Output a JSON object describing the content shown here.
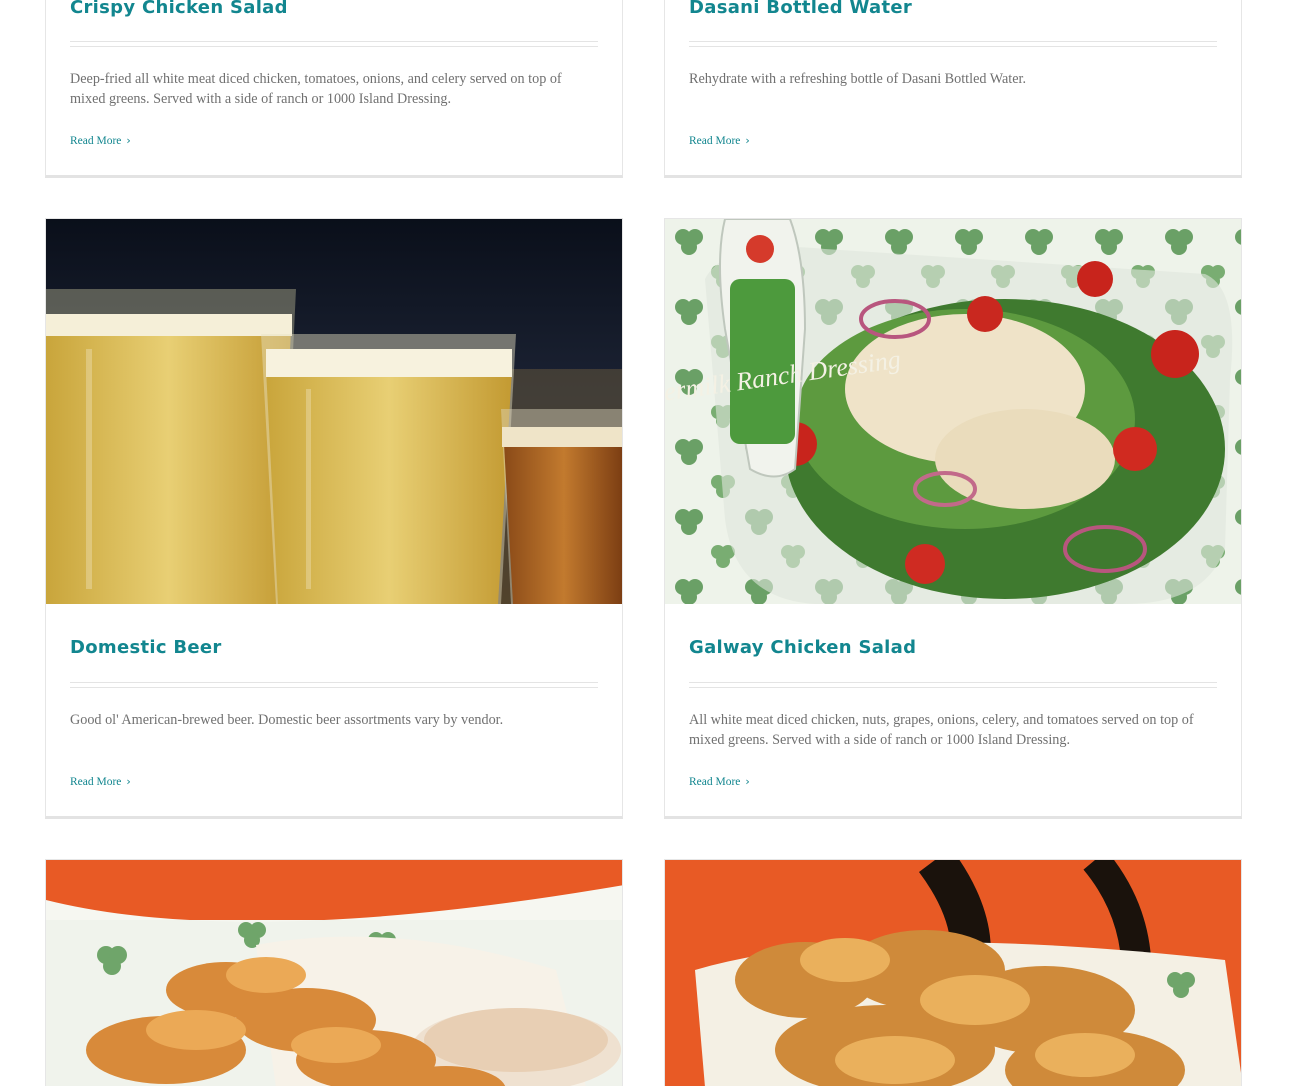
{
  "colors": {
    "accent": "#12868f",
    "text": "#707070",
    "border": "#e4e4e4"
  },
  "cards": [
    {
      "title": "Crispy Chicken Salad",
      "description": "Deep-fried all white meat diced chicken, tomatoes, onions, and celery served on top of mixed greens. Served with a side of ranch or 1000 Island Dressing.",
      "read_more": "Read More",
      "chevron_icon": "chevron-right-icon"
    },
    {
      "title": "Dasani Bottled Water",
      "description": "Rehydrate with a refreshing bottle of Dasani Bottled Water.",
      "read_more": "Read More",
      "chevron_icon": "chevron-right-icon"
    },
    {
      "title": "Domestic Beer",
      "description": "Good ol' American-brewed beer. Domestic beer assortments vary by vendor.",
      "read_more": "Read More",
      "chevron_icon": "chevron-right-icon",
      "image": "beer-glasses-photo"
    },
    {
      "title": "Galway Chicken Salad",
      "description": "All white meat diced chicken, nuts, grapes, onions, celery, and tomatoes served on top of mixed greens. Served with a side of ranch or 1000 Island Dressing.",
      "read_more": "Read More",
      "chevron_icon": "chevron-right-icon",
      "image": "galway-chicken-salad-photo",
      "image_text": {
        "label": "Buttermilk Ranch Dressing"
      }
    },
    {
      "image": "chips-with-dip-photo"
    },
    {
      "image": "potato-chips-photo"
    }
  ]
}
